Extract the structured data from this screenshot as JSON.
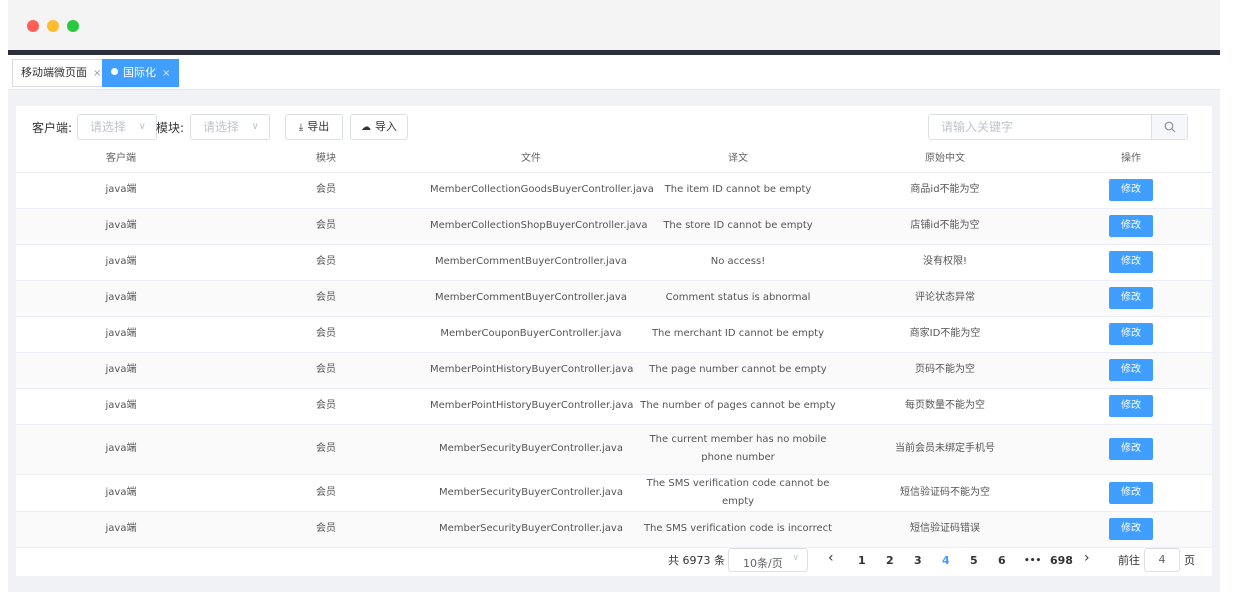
{
  "tabs": [
    {
      "label": "移动端微页面",
      "close": "×"
    },
    {
      "label": "国际化",
      "close": "×"
    }
  ],
  "filters": {
    "client_label": "客户端:",
    "client_placeholder": "请选择",
    "module_label": "模块:",
    "module_placeholder": "请选择",
    "export_label": "导出",
    "import_label": "导入",
    "search_placeholder": "请输入关键字"
  },
  "table": {
    "headers": [
      "客户端",
      "模块",
      "文件",
      "译文",
      "原始中文",
      "操作"
    ],
    "rows": [
      [
        "java端",
        "会员",
        "MemberCollectionGoodsBuyerController.java",
        "The item ID cannot be empty",
        "商品id不能为空",
        "修改"
      ],
      [
        "java端",
        "会员",
        "MemberCollectionShopBuyerController.java",
        "The store ID cannot be empty",
        "店铺id不能为空",
        "修改"
      ],
      [
        "java端",
        "会员",
        "MemberCommentBuyerController.java",
        "No access!",
        "没有权限!",
        "修改"
      ],
      [
        "java端",
        "会员",
        "MemberCommentBuyerController.java",
        "Comment status is abnormal",
        "评论状态异常",
        "修改"
      ],
      [
        "java端",
        "会员",
        "MemberCouponBuyerController.java",
        "The merchant ID cannot be empty",
        "商家ID不能为空",
        "修改"
      ],
      [
        "java端",
        "会员",
        "MemberPointHistoryBuyerController.java",
        "The page number cannot be empty",
        "页码不能为空",
        "修改"
      ],
      [
        "java端",
        "会员",
        "MemberPointHistoryBuyerController.java",
        "The number of pages cannot be empty",
        "每页数量不能为空",
        "修改"
      ],
      [
        "java端",
        "会员",
        "MemberSecurityBuyerController.java",
        "The current member has no mobile phone number",
        "当前会员未绑定手机号",
        "修改"
      ],
      [
        "java端",
        "会员",
        "MemberSecurityBuyerController.java",
        "The SMS verification code cannot be empty",
        "短信验证码不能为空",
        "修改"
      ],
      [
        "java端",
        "会员",
        "MemberSecurityBuyerController.java",
        "The SMS verification code is incorrect",
        "短信验证码错误",
        "修改"
      ]
    ]
  },
  "pagination": {
    "total": "共 6973 条",
    "page_size": "10条/页",
    "prev": "‹",
    "next": "›",
    "pages": [
      "1",
      "2",
      "3",
      "4",
      "5",
      "6",
      "•••",
      "698"
    ],
    "current_page": "4",
    "goto_label": "前往",
    "goto_value": "4",
    "goto_suffix": "页"
  },
  "colors": {
    "primary": "#409eff",
    "dark_bar": "#2b2f3a"
  }
}
